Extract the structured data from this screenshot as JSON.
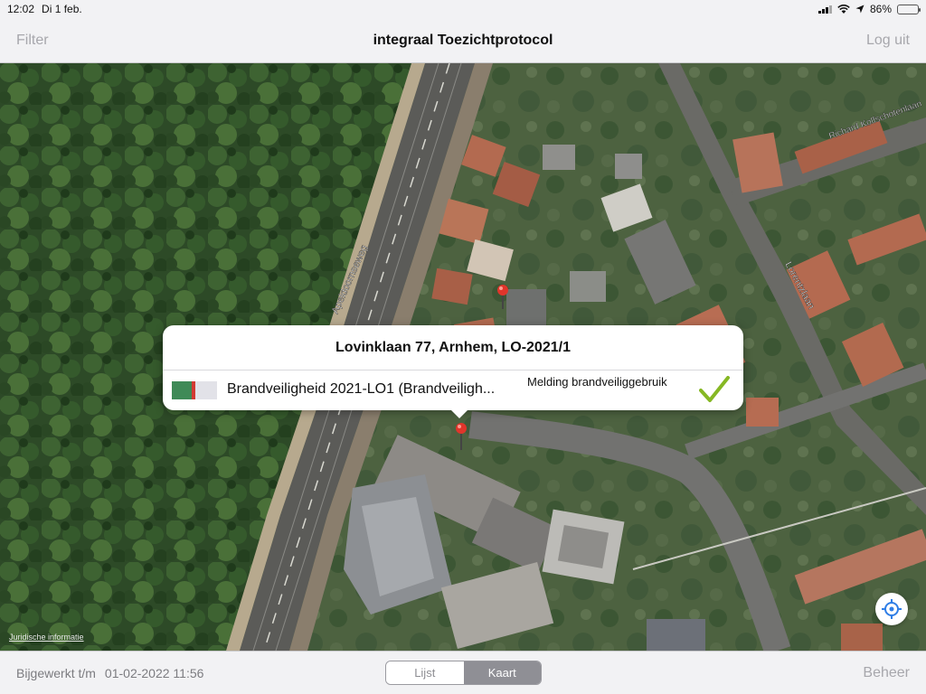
{
  "status_bar": {
    "time": "12:02",
    "date": "Di 1 feb.",
    "battery": "86%",
    "battery_level": 0.86
  },
  "nav": {
    "left": "Filter",
    "title": "integraal Toezichtprotocol",
    "right": "Log uit"
  },
  "map": {
    "labels": [
      "Apeldoornseweg",
      "Lorentzlaan",
      "Richard Kolfschotenlaan"
    ],
    "legal": "Juridische informatie"
  },
  "callout": {
    "title": "Lovinklaan 77, Arnhem, LO-2021/1",
    "item": {
      "title": "Brandveiligheid 2021-LO1 (Brandveiligh...",
      "status": "Melding brandveiliggebruik",
      "colors": {
        "done": "#3f8a57",
        "marker": "#d33a33",
        "open": "#e2e2e8"
      },
      "check_icon": "checkmark-icon",
      "check_color": "#86b824"
    }
  },
  "bottom": {
    "updated_label": "Bijgewerkt t/m",
    "updated_value": "01-02-2022 11:56",
    "segments": [
      {
        "label": "Lijst",
        "selected": false
      },
      {
        "label": "Kaart",
        "selected": true
      }
    ],
    "right": "Beheer"
  }
}
